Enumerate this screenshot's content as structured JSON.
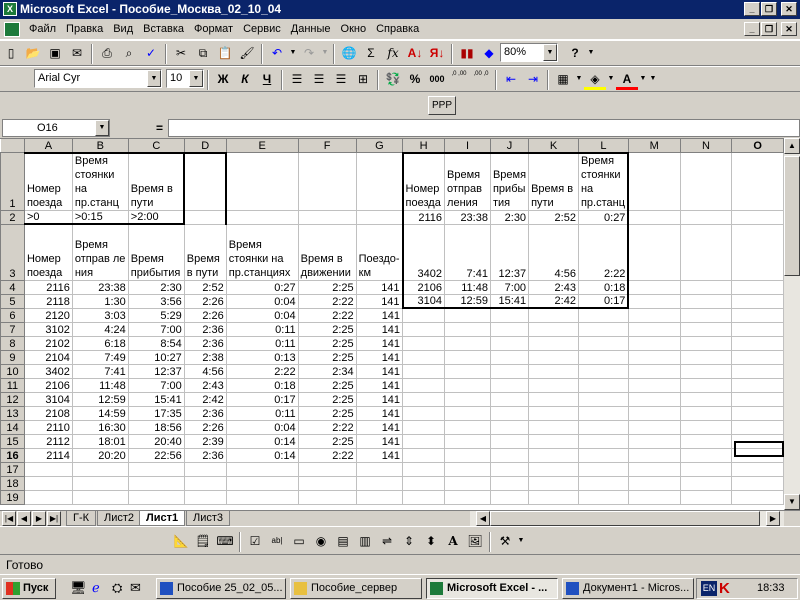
{
  "window": {
    "title": "Microsoft Excel - Пособие_Москва_02_10_04",
    "minimize": "_",
    "restore": "❐",
    "close": "✕"
  },
  "menu": [
    "Файл",
    "Правка",
    "Вид",
    "Вставка",
    "Формат",
    "Сервис",
    "Данные",
    "Окно",
    "Справка"
  ],
  "toolbar": {
    "zoom": "80%",
    "help": "?"
  },
  "format_toolbar": {
    "font_name": "Arial Cyr",
    "font_size": "10",
    "bold": "Ж",
    "italic": "К",
    "underline": "Ч",
    "percent": "%",
    "thousands": "000",
    "inc_decimal": ",0 ,00",
    "dec_decimal": ",00 ,0"
  },
  "custom_button": "РРР",
  "formula_bar": {
    "name_box": "O16",
    "equals": "="
  },
  "columns": [
    "",
    "A",
    "B",
    "C",
    "D",
    "E",
    "F",
    "G",
    "H",
    "I",
    "J",
    "K",
    "L",
    "M",
    "N",
    "O"
  ],
  "rows": [
    {
      "n": "1",
      "cells": [
        "Номер поезда",
        "Время стоянки на пр.станц",
        "Время в пути",
        "",
        "",
        "",
        "",
        "Номер поезда",
        "Время отправ ления",
        "Время прибы тия",
        "Время в пути",
        "Время стоянки на пр.станц",
        "",
        "",
        ""
      ]
    },
    {
      "n": "2",
      "cells": [
        ">0",
        ">0:15",
        ">2:00",
        "",
        "",
        "",
        "",
        "2116",
        "23:38",
        "2:30",
        "2:52",
        "0:27",
        "",
        "",
        ""
      ]
    },
    {
      "n": "3",
      "cells": [
        "Номер поезда",
        "Время отправ ле ния",
        "Время прибытия",
        "Время в пути",
        "Время стоянки на пр.станциях",
        "Время в движении",
        "Поездо-км",
        "3402",
        "7:41",
        "12:37",
        "4:56",
        "2:22",
        "",
        "",
        ""
      ]
    },
    {
      "n": "4",
      "cells": [
        "2116",
        "23:38",
        "2:30",
        "2:52",
        "0:27",
        "2:25",
        "141",
        "2106",
        "11:48",
        "7:00",
        "2:43",
        "0:18",
        "",
        "",
        ""
      ]
    },
    {
      "n": "5",
      "cells": [
        "2118",
        "1:30",
        "3:56",
        "2:26",
        "0:04",
        "2:22",
        "141",
        "3104",
        "12:59",
        "15:41",
        "2:42",
        "0:17",
        "",
        "",
        ""
      ]
    },
    {
      "n": "6",
      "cells": [
        "2120",
        "3:03",
        "5:29",
        "2:26",
        "0:04",
        "2:22",
        "141",
        "",
        "",
        "",
        "",
        "",
        "",
        "",
        ""
      ]
    },
    {
      "n": "7",
      "cells": [
        "3102",
        "4:24",
        "7:00",
        "2:36",
        "0:11",
        "2:25",
        "141",
        "",
        "",
        "",
        "",
        "",
        "",
        "",
        ""
      ]
    },
    {
      "n": "8",
      "cells": [
        "2102",
        "6:18",
        "8:54",
        "2:36",
        "0:11",
        "2:25",
        "141",
        "",
        "",
        "",
        "",
        "",
        "",
        "",
        ""
      ]
    },
    {
      "n": "9",
      "cells": [
        "2104",
        "7:49",
        "10:27",
        "2:38",
        "0:13",
        "2:25",
        "141",
        "",
        "",
        "",
        "",
        "",
        "",
        "",
        ""
      ]
    },
    {
      "n": "10",
      "cells": [
        "3402",
        "7:41",
        "12:37",
        "4:56",
        "2:22",
        "2:34",
        "141",
        "",
        "",
        "",
        "",
        "",
        "",
        "",
        ""
      ]
    },
    {
      "n": "11",
      "cells": [
        "2106",
        "11:48",
        "7:00",
        "2:43",
        "0:18",
        "2:25",
        "141",
        "",
        "",
        "",
        "",
        "",
        "",
        "",
        ""
      ]
    },
    {
      "n": "12",
      "cells": [
        "3104",
        "12:59",
        "15:41",
        "2:42",
        "0:17",
        "2:25",
        "141",
        "",
        "",
        "",
        "",
        "",
        "",
        "",
        ""
      ]
    },
    {
      "n": "13",
      "cells": [
        "2108",
        "14:59",
        "17:35",
        "2:36",
        "0:11",
        "2:25",
        "141",
        "",
        "",
        "",
        "",
        "",
        "",
        "",
        ""
      ]
    },
    {
      "n": "14",
      "cells": [
        "2110",
        "16:30",
        "18:56",
        "2:26",
        "0:04",
        "2:22",
        "141",
        "",
        "",
        "",
        "",
        "",
        "",
        "",
        ""
      ]
    },
    {
      "n": "15",
      "cells": [
        "2112",
        "18:01",
        "20:40",
        "2:39",
        "0:14",
        "2:25",
        "141",
        "",
        "",
        "",
        "",
        "",
        "",
        "",
        ""
      ]
    },
    {
      "n": "16",
      "cells": [
        "2114",
        "20:20",
        "22:56",
        "2:36",
        "0:14",
        "2:22",
        "141",
        "",
        "",
        "",
        "",
        "",
        "",
        "",
        ""
      ]
    },
    {
      "n": "17",
      "cells": [
        "",
        "",
        "",
        "",
        "",
        "",
        "",
        "",
        "",
        "",
        "",
        "",
        "",
        "",
        ""
      ]
    },
    {
      "n": "18",
      "cells": [
        "",
        "",
        "",
        "",
        "",
        "",
        "",
        "",
        "",
        "",
        "",
        "",
        "",
        "",
        ""
      ]
    },
    {
      "n": "19",
      "cells": [
        "",
        "",
        "",
        "",
        "",
        "",
        "",
        "",
        "",
        "",
        "",
        "",
        "",
        "",
        ""
      ]
    }
  ],
  "sheet_tabs": [
    "Г-К",
    "Лист2",
    "Лист1",
    "Лист3"
  ],
  "active_sheet": "Лист1",
  "status": "Готово",
  "taskbar": {
    "start": "Пуск",
    "tasks": [
      "Пособие 25_02_05...",
      "Пособие_сервер",
      "Microsoft Excel - ...",
      "Документ1 - Micros..."
    ],
    "lang": "EN",
    "clock": "18:33"
  }
}
